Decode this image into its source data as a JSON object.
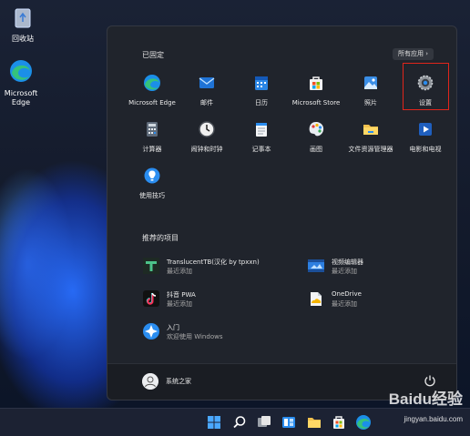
{
  "desktop": {
    "icons": [
      {
        "label": "回收站",
        "icon": "recycle-bin-icon"
      },
      {
        "label": "Microsoft Edge",
        "icon": "edge-icon"
      }
    ]
  },
  "start_menu": {
    "pinned_title": "已固定",
    "all_apps_label": "所有应用",
    "all_apps_chevron": "›",
    "pinned": [
      {
        "label": "Microsoft Edge",
        "icon": "edge-icon"
      },
      {
        "label": "邮件",
        "icon": "mail-icon"
      },
      {
        "label": "日历",
        "icon": "calendar-icon"
      },
      {
        "label": "Microsoft Store",
        "icon": "store-icon"
      },
      {
        "label": "照片",
        "icon": "photos-icon"
      },
      {
        "label": "设置",
        "icon": "settings-gear-icon"
      },
      {
        "label": "计算器",
        "icon": "calculator-icon"
      },
      {
        "label": "闹钟和时钟",
        "icon": "clock-icon"
      },
      {
        "label": "记事本",
        "icon": "notepad-icon"
      },
      {
        "label": "画图",
        "icon": "paint-icon"
      },
      {
        "label": "文件资源管理器",
        "icon": "folder-icon"
      },
      {
        "label": "电影和电视",
        "icon": "movies-icon"
      },
      {
        "label": "使用技巧",
        "icon": "tips-icon"
      }
    ],
    "recommended_title": "推荐的项目",
    "recommended": [
      {
        "title": "TranslucentTB(汉化 by tpxxn)",
        "subtitle": "最近添加",
        "icon": "translucenttb-icon"
      },
      {
        "title": "视频编辑器",
        "subtitle": "最近添加",
        "icon": "video-editor-icon"
      },
      {
        "title": "抖音 PWA",
        "subtitle": "最近添加",
        "icon": "douyin-icon"
      },
      {
        "title": "OneDrive",
        "subtitle": "最近添加",
        "icon": "onedrive-icon"
      },
      {
        "title": "入门",
        "subtitle": "欢迎使用 Windows",
        "icon": "get-started-icon"
      }
    ],
    "user_name": "系统之家",
    "power_icon": "power-icon"
  },
  "taskbar": {
    "items": [
      "windows-start-icon",
      "search-icon",
      "task-view-icon",
      "widgets-icon",
      "file-explorer-icon",
      "store-icon",
      "edge-icon"
    ]
  },
  "watermark": {
    "brand": "Baidu经验",
    "url": "jingyan.baidu.com"
  },
  "colors": {
    "highlight_border": "#e1251b",
    "start_bg": "#20242c"
  }
}
